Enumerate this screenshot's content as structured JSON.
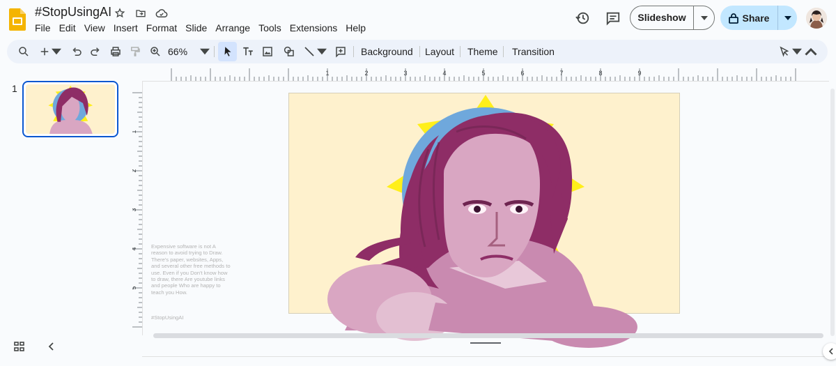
{
  "header": {
    "doc_title": "#StopUsingAI",
    "menu": [
      "File",
      "Edit",
      "View",
      "Insert",
      "Format",
      "Slide",
      "Arrange",
      "Tools",
      "Extensions",
      "Help"
    ],
    "slideshow_label": "Slideshow",
    "share_label": "Share"
  },
  "toolbar": {
    "zoom": "66%",
    "buttons": [
      "Background",
      "Layout",
      "Theme",
      "Transition"
    ]
  },
  "ruler": {
    "horizontal": [
      "1",
      "2",
      "3",
      "4",
      "5",
      "6",
      "7",
      "8",
      "9"
    ],
    "vertical": [
      "1",
      "2",
      "3",
      "4",
      "5"
    ]
  },
  "filmstrip": {
    "slide_number": "1"
  },
  "slide": {
    "side_text": "Expensive software is not A reason to avoid trying to Draw. There's paper, websites, Apps, and several other free methods to use. Even if you Don't know how to draw, there Are youtube links and people Who are happy to teach you How.",
    "side_tag": "#StopUsingAI"
  },
  "colors": {
    "accent": "#0b57d0",
    "share_bg": "#c2e7ff",
    "slide_bg": "#fef1cd",
    "halo_blue": "#6fa8dc",
    "halo_star": "#ffef1a",
    "hair": "#8e2d66",
    "skin": "#d9a6c2"
  },
  "icons": [
    "slides-logo-icon",
    "star-icon",
    "move-folder-icon",
    "cloud-icon",
    "history-icon",
    "comment-icon",
    "lock-icon",
    "search-icon",
    "plus-icon",
    "undo-icon",
    "redo-icon",
    "print-icon",
    "paint-format-icon",
    "zoom-icon",
    "select-cursor-icon",
    "textbox-icon",
    "image-icon",
    "shape-icon",
    "line-icon",
    "comment-add-icon",
    "pen-icon",
    "chevron-up-icon",
    "grid-view-icon",
    "chevron-left-icon"
  ]
}
